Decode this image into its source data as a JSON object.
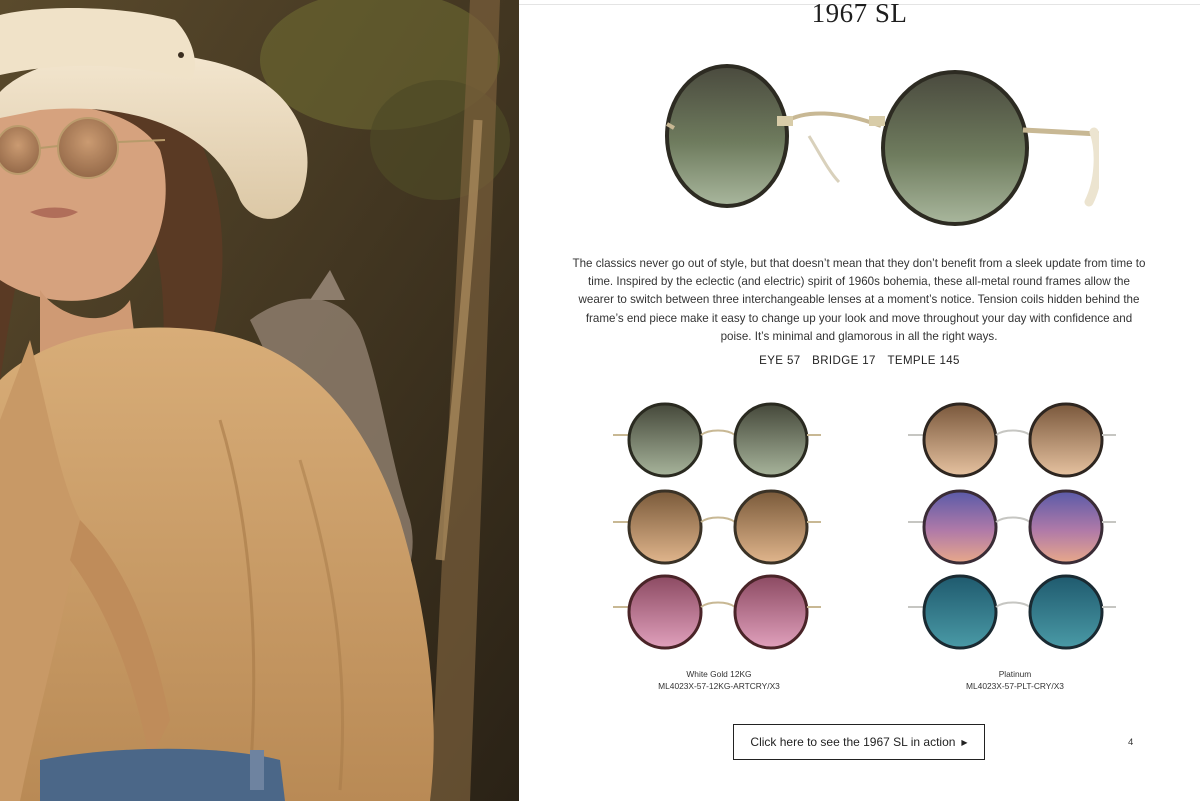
{
  "product": {
    "title": "1967 SL",
    "description": "The classics never go out of style, but that doesn’t mean that they don’t benefit from a sleek update from time to time. Inspired by the eclectic (and electric) spirit of 1960s bohemia, these all-metal round frames allow the wearer to switch between three interchangeable lenses at a moment’s notice. Tension coils hidden behind the frame’s end piece make it easy to change up your look and move throughout your day with confidence and poise. It’s minimal and glamorous in all the right ways.",
    "specs": {
      "eye": "EYE 57",
      "bridge": "BRIDGE 17",
      "temple": "TEMPLE 145"
    }
  },
  "variants": [
    {
      "finish": "White Gold 12KG",
      "sku": "ML4023X-57-12KG-ARTCRY/X3",
      "lenses": [
        "green-gradient",
        "brown-gradient",
        "rose"
      ]
    },
    {
      "finish": "Platinum",
      "sku": "ML4023X-57-PLT-CRY/X3",
      "lenses": [
        "brown-gradient",
        "purple-sunset-gradient",
        "teal-blue"
      ]
    }
  ],
  "cta": {
    "label": "Click here to see the 1967 SL in action",
    "icon": "play-arrow-icon"
  },
  "page_number": "4",
  "colors": {
    "frame_gold": "#c8b894",
    "frame_dark": "#2e2a20"
  }
}
